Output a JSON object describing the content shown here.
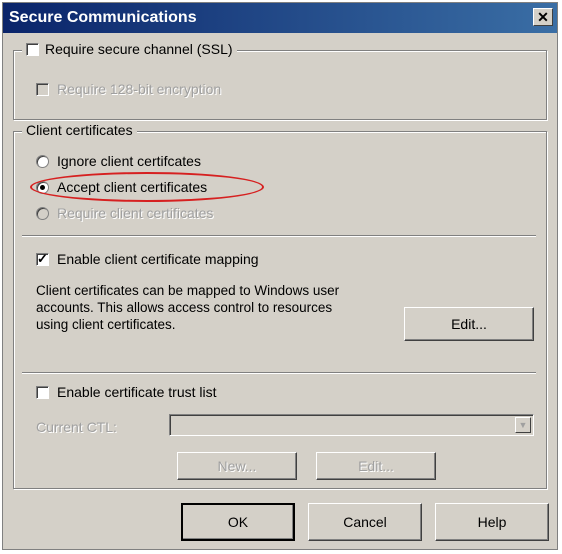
{
  "window": {
    "title": "Secure Communications",
    "close_glyph": "✕"
  },
  "ssl_group": {
    "require_secure_channel": {
      "label": "Require secure channel (SSL)",
      "checked": false
    },
    "require_128": {
      "label": "Require 128-bit encryption",
      "checked": false,
      "enabled": false
    }
  },
  "client_certs": {
    "group_title": "Client certificates",
    "options": [
      {
        "label": "Ignore client certifcates",
        "selected": false,
        "enabled": true
      },
      {
        "label": "Accept client certificates",
        "selected": true,
        "enabled": true
      },
      {
        "label": "Require client certificates",
        "selected": false,
        "enabled": false
      }
    ],
    "mapping": {
      "label": "Enable client certificate mapping",
      "checked": true,
      "description": [
        "Client certificates can be mapped to Windows user",
        "accounts.  This allows access control to resources",
        "using client certificates."
      ],
      "edit_label": "Edit..."
    },
    "trust_list": {
      "label": "Enable certificate trust list",
      "checked": false,
      "current_ctl_label": "Current CTL:",
      "current_ctl_value": "",
      "new_label": "New...",
      "edit_label": "Edit..."
    }
  },
  "buttons": {
    "ok": "OK",
    "cancel": "Cancel",
    "help": "Help"
  },
  "annotation": {
    "color": "#d62020"
  }
}
